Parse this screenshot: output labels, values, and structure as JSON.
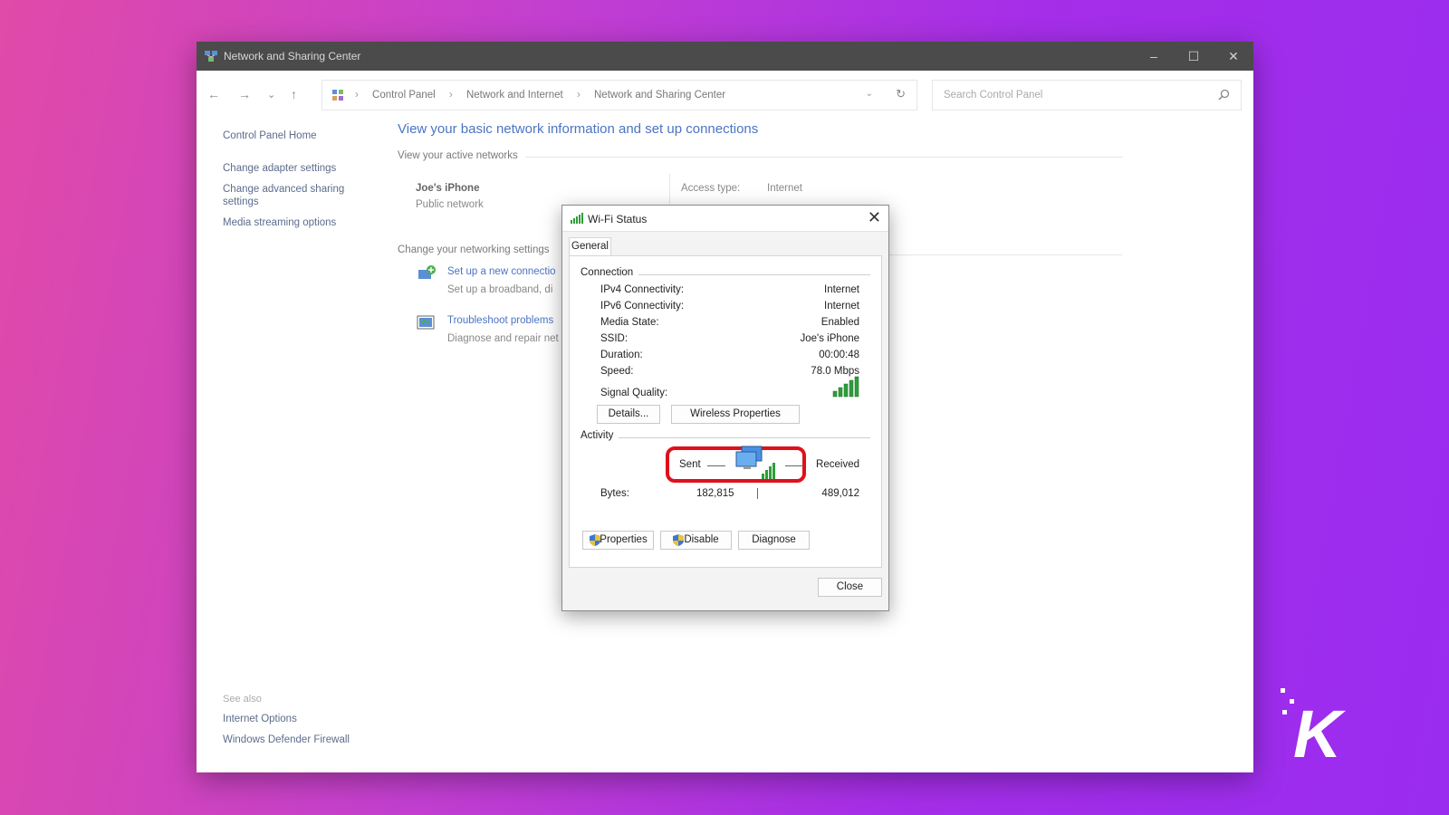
{
  "window": {
    "title": "Network and Sharing Center",
    "controls": {
      "minimize": "–",
      "maximize": "☐",
      "close": "✕"
    }
  },
  "nav": {
    "back": "←",
    "forward": "→",
    "recent": "⌄",
    "up": "↑",
    "breadcrumb": [
      "Control Panel",
      "Network and Internet",
      "Network and Sharing Center"
    ],
    "search_placeholder": "Search Control Panel"
  },
  "sidebar": {
    "items": [
      {
        "label": "Control Panel Home"
      },
      {
        "label": "Change adapter settings"
      },
      {
        "label": "Change advanced sharing"
      },
      {
        "label": "settings"
      },
      {
        "label": "Media streaming options"
      }
    ],
    "see_also_title": "See also",
    "see_also": [
      "Internet Options",
      "Windows Defender Firewall"
    ]
  },
  "main": {
    "heading": "View your basic network information and set up connections",
    "active_networks_label": "View your active networks",
    "network_name": "Joe's iPhone",
    "network_type": "Public network",
    "access_type_label": "Access type:",
    "access_type_value": "Internet",
    "change_settings_label": "Change your networking settings",
    "tasks": [
      {
        "link": "Set up a new connectio",
        "desc": "Set up a broadband, di"
      },
      {
        "link": "Troubleshoot problems",
        "desc": "Diagnose and repair net"
      }
    ]
  },
  "dialog": {
    "title": "Wi-Fi Status",
    "close_glyph": "✕",
    "tab": "General",
    "connection_label": "Connection",
    "rows": [
      {
        "label": "IPv4 Connectivity:",
        "value": "Internet"
      },
      {
        "label": "IPv6 Connectivity:",
        "value": "Internet"
      },
      {
        "label": "Media State:",
        "value": "Enabled"
      },
      {
        "label": "SSID:",
        "value": "Joe's iPhone"
      },
      {
        "label": "Duration:",
        "value": "00:00:48"
      },
      {
        "label": "Speed:",
        "value": "78.0 Mbps"
      }
    ],
    "signal_label": "Signal Quality:",
    "signal_bars": 5,
    "details_button": "Details...",
    "wireless_button": "Wireless Properties",
    "activity_label": "Activity",
    "sent_label": "Sent",
    "received_label": "Received",
    "bytes_label": "Bytes:",
    "bytes_sent": "182,815",
    "bytes_received": "489,012",
    "properties_button": "Properties",
    "disable_button": "Disable",
    "diagnose_button": "Diagnose",
    "close_button": "Close"
  },
  "colors": {
    "link": "#4b74c4",
    "highlight": "#e0101a",
    "signal": "#2e9e3a"
  },
  "logo_text": "K"
}
